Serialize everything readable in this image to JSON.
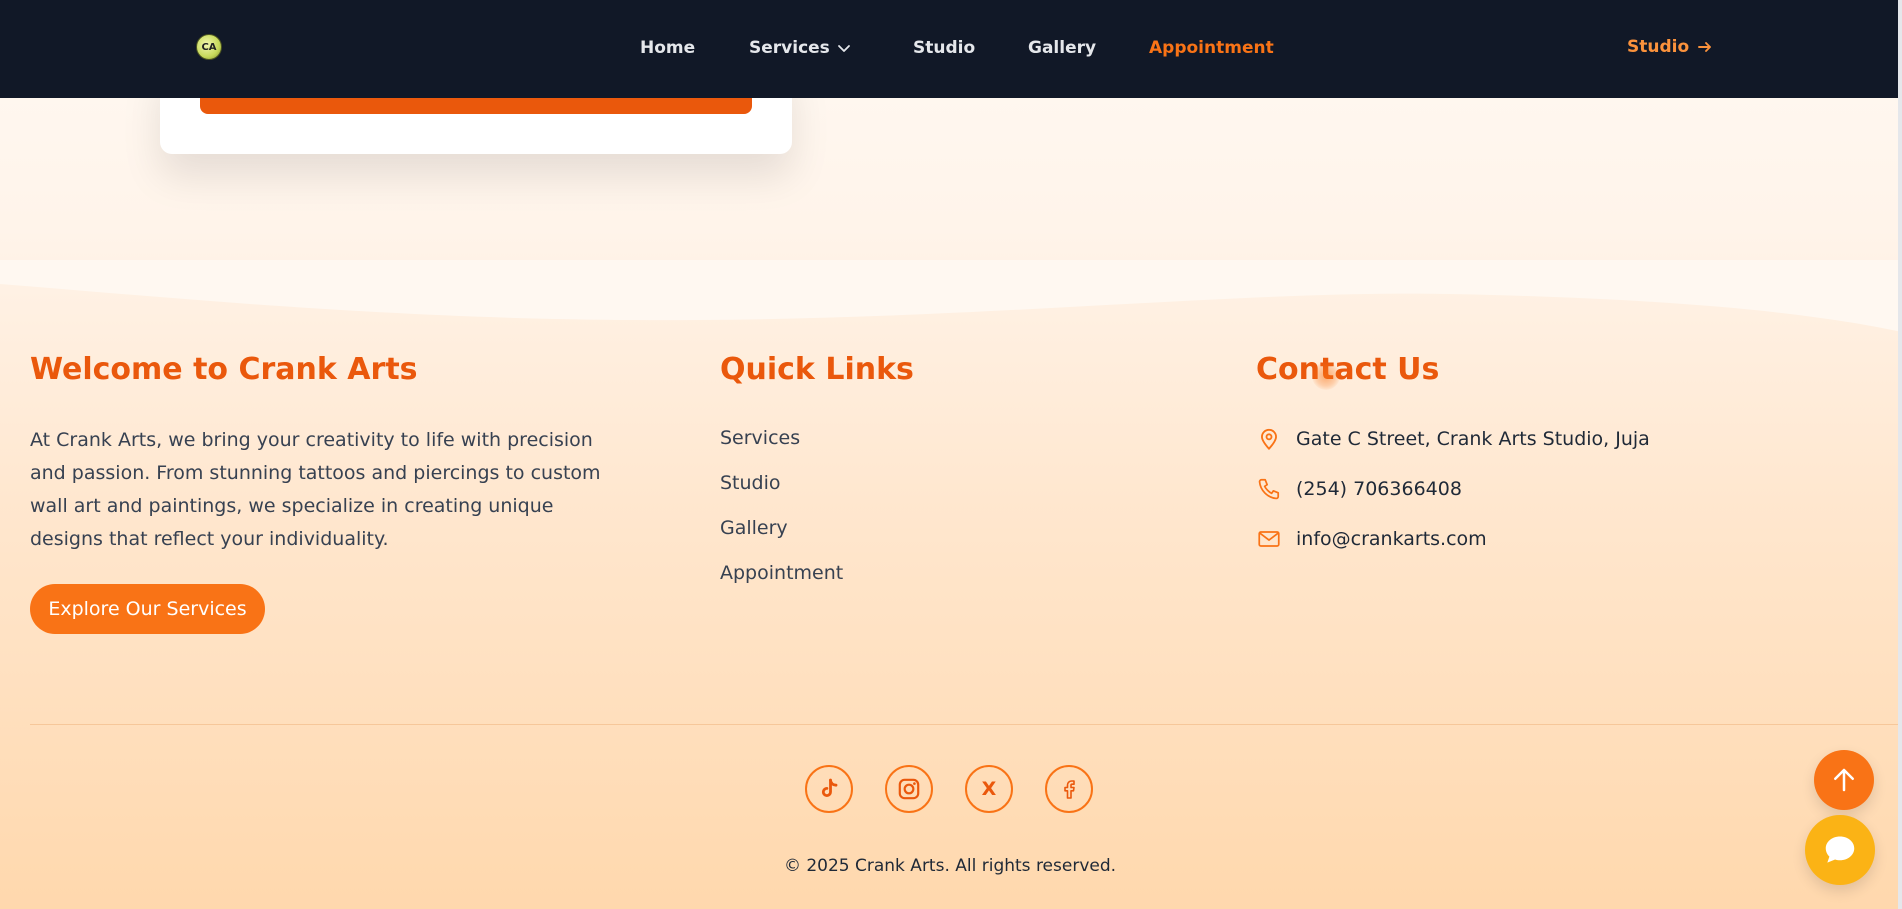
{
  "nav": {
    "logo_text": "CA",
    "items": [
      {
        "label": "Home"
      },
      {
        "label": "Services"
      },
      {
        "label": "Studio"
      },
      {
        "label": "Gallery"
      },
      {
        "label": "Appointment"
      }
    ],
    "cta_label": "Studio"
  },
  "footer": {
    "about": {
      "title": "Welcome to Crank Arts",
      "text": "At Crank Arts, we bring your creativity to life with precision and passion. From stunning tattoos and piercings to custom wall art and paintings, we specialize in creating unique designs that reflect your individuality.",
      "button_label": "Explore Our Services"
    },
    "quick_links": {
      "title": "Quick Links",
      "items": [
        {
          "label": "Services"
        },
        {
          "label": "Studio"
        },
        {
          "label": "Gallery"
        },
        {
          "label": "Appointment"
        }
      ]
    },
    "contact": {
      "title": "Contact Us",
      "address": "Gate C Street, Crank Arts Studio, Juja",
      "phone": "(254) 706366408",
      "email": "info@crankarts.com"
    },
    "social": [
      {
        "icon": "tiktok-icon"
      },
      {
        "icon": "instagram-icon"
      },
      {
        "icon": "x-icon",
        "glyph": "X"
      },
      {
        "icon": "facebook-icon"
      }
    ],
    "copyright": "© 2025 Crank Arts. All rights reserved."
  },
  "colors": {
    "accent": "#f97316",
    "accent_dark": "#ea580c",
    "nav_bg": "#111827",
    "chat": "#fbb315"
  }
}
